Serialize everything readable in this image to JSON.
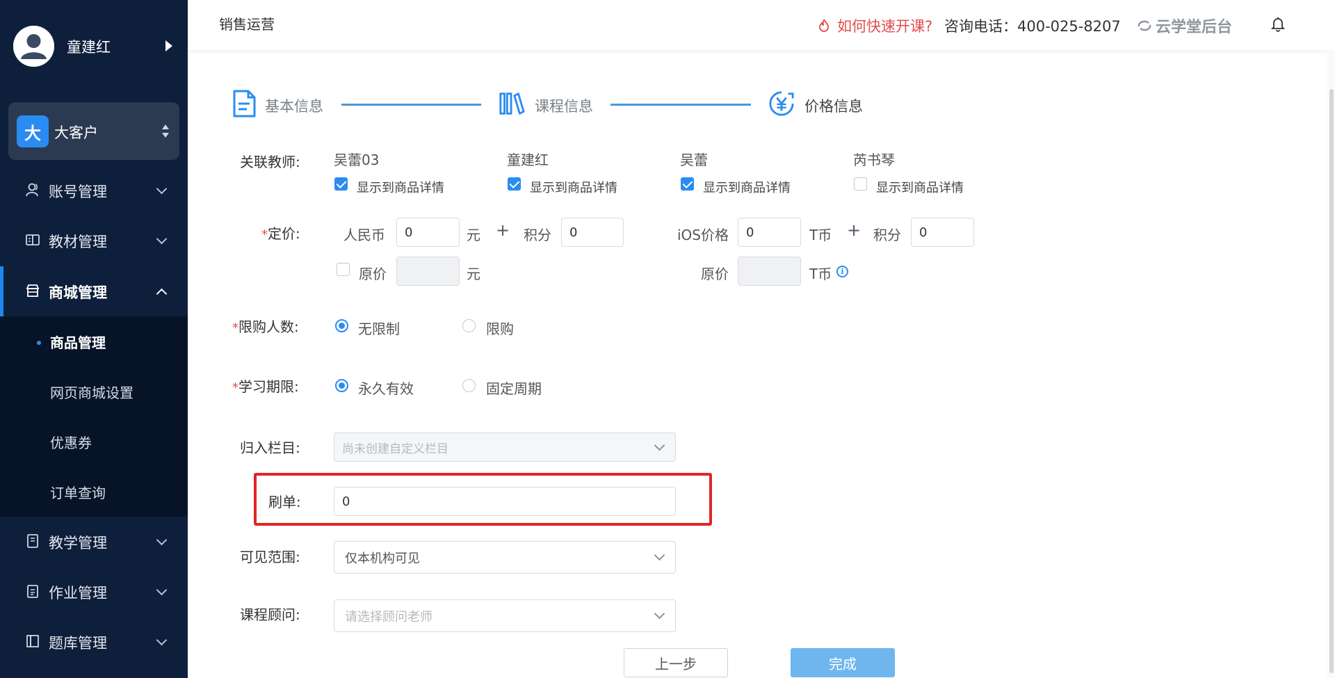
{
  "sidebar": {
    "user_name": "童建红",
    "org_badge": "大",
    "org_name": "大客户",
    "menu": [
      {
        "label": "账号管理",
        "icon": "user-icon"
      },
      {
        "label": "教材管理",
        "icon": "book-icon"
      },
      {
        "label": "商城管理",
        "icon": "shop-icon"
      },
      {
        "label": "教学管理",
        "icon": "notebook-icon"
      },
      {
        "label": "作业管理",
        "icon": "clipboard-icon"
      },
      {
        "label": "题库管理",
        "icon": "library-icon"
      }
    ],
    "submenu": [
      {
        "label": "商品管理"
      },
      {
        "label": "网页商城设置"
      },
      {
        "label": "优惠券"
      },
      {
        "label": "订单查询"
      }
    ]
  },
  "header": {
    "crumb": "销售运营",
    "help_link": "如何快速开课?",
    "phone": "咨询电话：400-025-8207",
    "brand": "云学堂后台"
  },
  "steps": [
    {
      "label": "基本信息",
      "icon": "document-icon"
    },
    {
      "label": "课程信息",
      "icon": "books-icon"
    },
    {
      "label": "价格信息",
      "icon": "yuan-icon"
    }
  ],
  "form": {
    "teachers_label": "关联教师:",
    "teachers": [
      {
        "name": "吴蕾03",
        "checked": true
      },
      {
        "name": "童建红",
        "checked": true
      },
      {
        "name": "吴蕾",
        "checked": true
      },
      {
        "name": "芮书琴",
        "checked": false
      }
    ],
    "show_detail_label": "显示到商品详情",
    "price_label": "定价:",
    "rmb_label": "人民币",
    "rmb_value": "0",
    "yuan_unit": "元",
    "points_label": "积分",
    "points_value": "0",
    "ios_label": "iOS价格",
    "ios_value": "0",
    "tcoin_unit": "T币",
    "ios_points_value": "0",
    "plus_sign": "+",
    "orig_label": "原价",
    "limit_label": "限购人数:",
    "limit_opt1": "无限制",
    "limit_opt2": "限购",
    "period_label": "学习期限:",
    "period_opt1": "永久有效",
    "period_opt2": "固定周期",
    "column_label": "归入栏目:",
    "column_placeholder": "尚未创建自定义栏目",
    "fake_orders_label": "刷单:",
    "fake_orders_value": "0",
    "visibility_label": "可见范围:",
    "visibility_value": "仅本机构可见",
    "advisor_label": "课程顾问:",
    "advisor_placeholder": "请选择顾问老师",
    "required_mark": "*",
    "info_glyph": "i"
  },
  "buttons": {
    "prev": "上一步",
    "done": "完成"
  },
  "colors": {
    "sidebar_bg": "#0e1f3b",
    "accent": "#2a8cf2",
    "help_red": "#e34d4d",
    "highlight_red": "#e02525",
    "done_button": "#6fb6ef"
  }
}
